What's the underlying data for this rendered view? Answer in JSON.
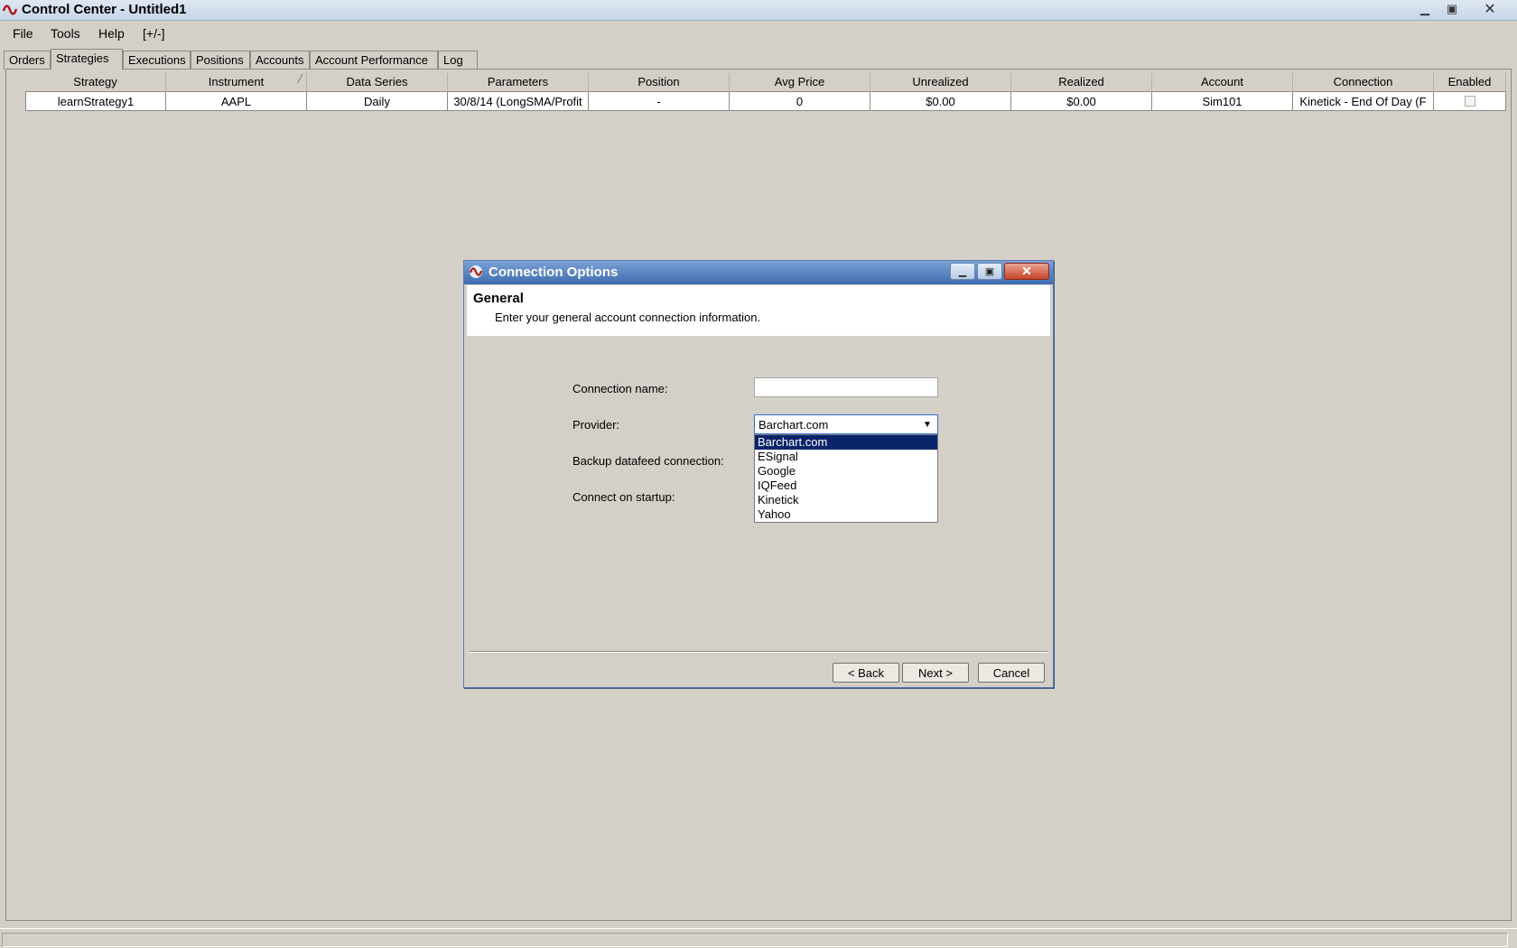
{
  "window": {
    "title": "Control Center - Untitled1",
    "controls": {
      "minimize": "minimize-icon",
      "maximize": "restore-icon",
      "close": "close-icon"
    }
  },
  "menu": [
    "File",
    "Tools",
    "Help",
    "[+/-]"
  ],
  "tabs": [
    "Orders",
    "Strategies",
    "Executions",
    "Positions",
    "Accounts",
    "Account Performance",
    "Log"
  ],
  "active_tab": "Strategies",
  "grid": {
    "columns": [
      "Strategy",
      "Instrument",
      "Data Series",
      "Parameters",
      "Position",
      "Avg Price",
      "Unrealized",
      "Realized",
      "Account",
      "Connection",
      "Enabled"
    ],
    "rows": [
      {
        "strategy": "learnStrategy1",
        "instrument": "AAPL",
        "data_series": "Daily",
        "parameters": "30/8/14 (LongSMA/Profit",
        "position": "-",
        "avg_price": "0",
        "unrealized": "$0.00",
        "realized": "$0.00",
        "account": "Sim101",
        "connection": "Kinetick - End Of Day (F",
        "enabled": false
      }
    ]
  },
  "dialog": {
    "title": "Connection Options",
    "section_title": "General",
    "section_subtitle": "Enter your general account connection information.",
    "labels": {
      "connection_name": "Connection name:",
      "provider": "Provider:",
      "backup": "Backup datafeed connection:",
      "startup": "Connect on startup:"
    },
    "connection_name_value": "",
    "provider_selected": "Barchart.com",
    "provider_options": [
      "Barchart.com",
      "ESignal",
      "Google",
      "IQFeed",
      "Kinetick",
      "Yahoo"
    ],
    "buttons": {
      "back": "< Back",
      "next": "Next >",
      "cancel": "Cancel"
    }
  },
  "colors": {
    "dialog_title_bar": "#3d6bb0",
    "selection_highlight": "#0a246a",
    "window_background": "#d4d0c8"
  }
}
